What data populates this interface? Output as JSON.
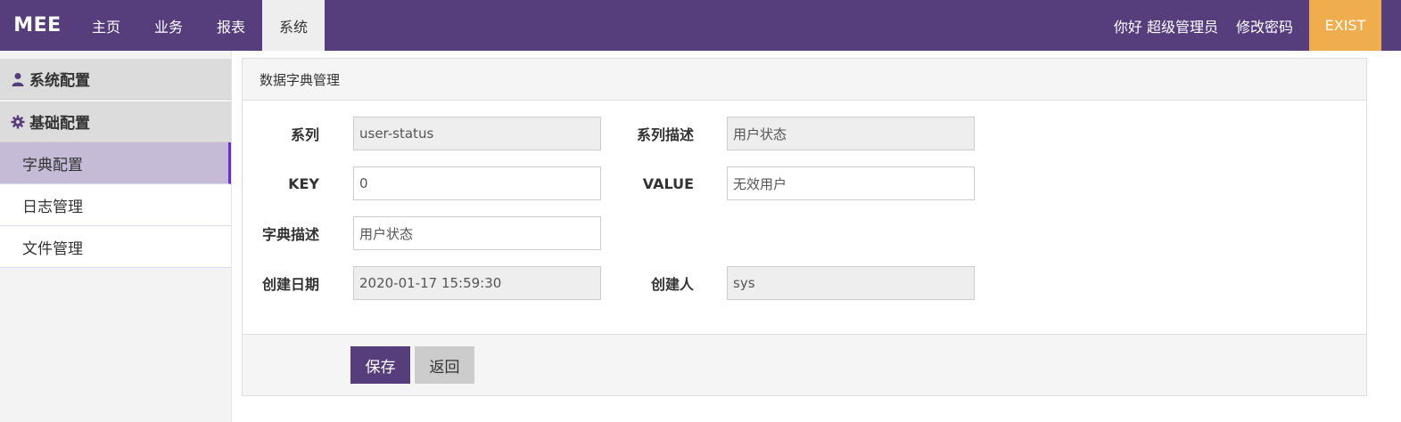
{
  "brand": "MEE",
  "nav": [
    {
      "label": "主页",
      "active": false
    },
    {
      "label": "业务",
      "active": false
    },
    {
      "label": "报表",
      "active": false
    },
    {
      "label": "系统",
      "active": true
    }
  ],
  "header_right": {
    "greeting": "你好 超级管理员",
    "change_password": "修改密码",
    "exit": "EXIST"
  },
  "sidebar": {
    "groups": [
      {
        "label": "系统配置",
        "icon": "user-icon"
      },
      {
        "label": "基础配置",
        "icon": "gear-icon"
      }
    ],
    "items": [
      {
        "label": "字典配置",
        "active": true
      },
      {
        "label": "日志管理",
        "active": false
      },
      {
        "label": "文件管理",
        "active": false
      }
    ]
  },
  "panel": {
    "title": "数据字典管理",
    "fields": {
      "series": {
        "label": "系列",
        "value": "user-status",
        "readonly": true
      },
      "series_desc": {
        "label": "系列描述",
        "value": "用户状态",
        "readonly": true
      },
      "key": {
        "label": "KEY",
        "value": "0",
        "readonly": false
      },
      "value": {
        "label": "VALUE",
        "value": "无效用户",
        "readonly": false
      },
      "dict_desc": {
        "label": "字典描述",
        "value": "用户状态",
        "readonly": false
      },
      "created_date": {
        "label": "创建日期",
        "value": "2020-01-17 15:59:30",
        "readonly": true
      },
      "creator": {
        "label": "创建人",
        "value": "sys",
        "readonly": true
      }
    },
    "buttons": {
      "save": "保存",
      "back": "返回"
    }
  },
  "colors": {
    "primary": "#563d7c",
    "exit": "#f0ad4e",
    "active_side": "#c5bbd6",
    "active_side_border": "#6b2bd9"
  }
}
